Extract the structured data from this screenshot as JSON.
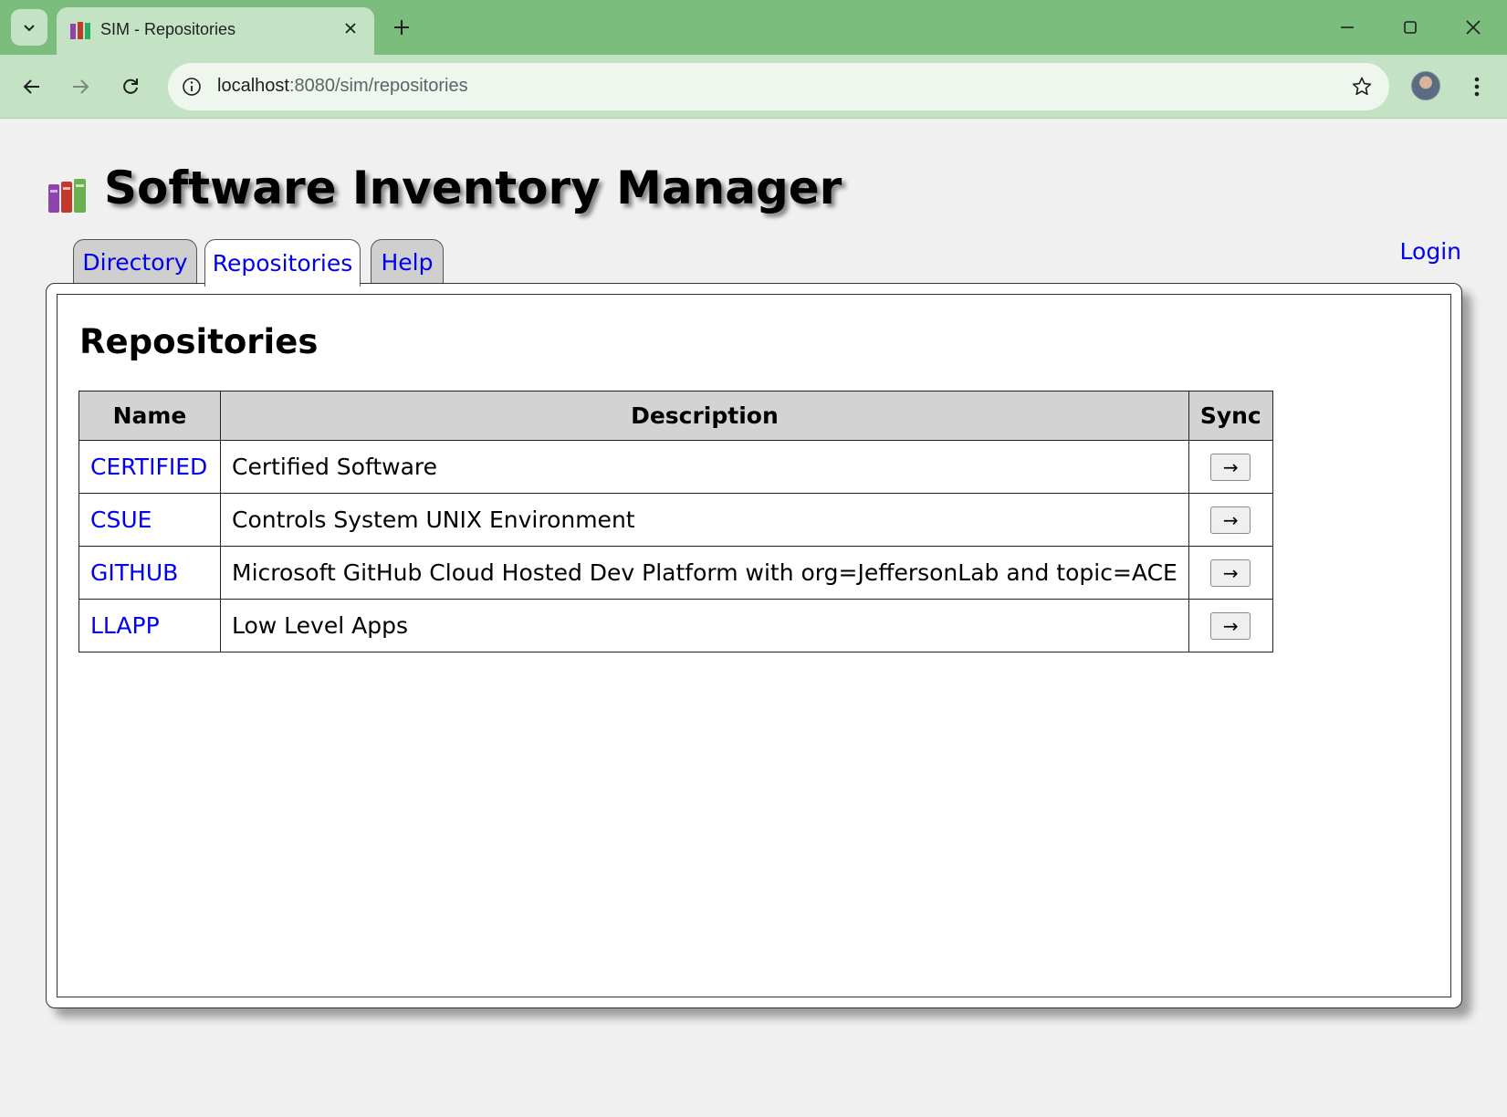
{
  "browser": {
    "tab_title": "SIM - Repositories",
    "url_host": "localhost",
    "url_path": ":8080/sim/repositories"
  },
  "page": {
    "site_title": "Software Inventory Manager",
    "login_label": "Login",
    "tabs": [
      {
        "label": "Directory",
        "active": false
      },
      {
        "label": "Repositories",
        "active": true
      },
      {
        "label": "Help",
        "active": false
      }
    ],
    "heading": "Repositories",
    "table": {
      "headers": [
        "Name",
        "Description",
        "Sync"
      ],
      "rows": [
        {
          "name": "CERTIFIED",
          "description": "Certified Software",
          "sync_label": "→"
        },
        {
          "name": "CSUE",
          "description": "Controls System UNIX Environment",
          "sync_label": "→"
        },
        {
          "name": "GITHUB",
          "description": "Microsoft GitHub Cloud Hosted Dev Platform with org=JeffersonLab and topic=ACE",
          "sync_label": "→"
        },
        {
          "name": "LLAPP",
          "description": "Low Level Apps",
          "sync_label": "→"
        }
      ]
    }
  },
  "colors": {
    "chrome_green": "#7bbd7c",
    "chrome_light_green": "#c4e3c5",
    "link_blue": "#0000ee"
  },
  "icons": {
    "favicon": "books-icon",
    "logo": "books-icon"
  }
}
